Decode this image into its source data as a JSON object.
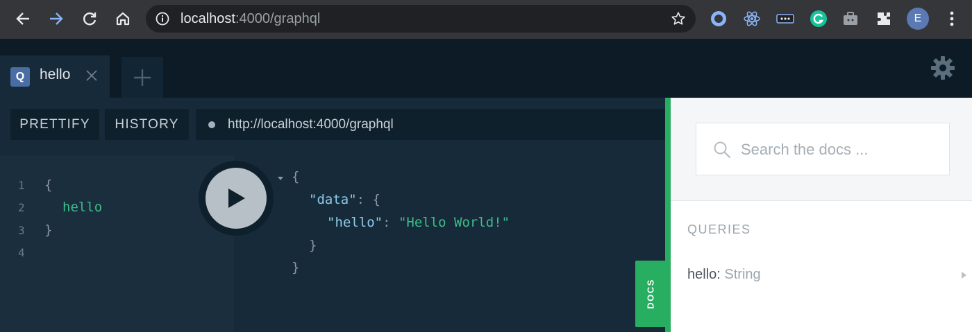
{
  "browser": {
    "url_host": "localhost",
    "url_rest": ":4000/graphql",
    "profile_initial": "E"
  },
  "tabs": [
    {
      "badge": "Q",
      "title": "hello"
    }
  ],
  "toolbar": {
    "prettify_label": "PRETTIFY",
    "history_label": "HISTORY",
    "endpoint_value": "http://localhost:4000/graphql"
  },
  "query_editor": {
    "line_numbers": [
      "1",
      "2",
      "3",
      "4"
    ],
    "lines": [
      "{",
      "hello",
      "}"
    ]
  },
  "result": {
    "open_brace": "{",
    "data_key": "\"data\"",
    "colon1": ": {",
    "hello_key": "\"hello\"",
    "colon2": ": ",
    "hello_value": "\"Hello World!\"",
    "inner_close": "}",
    "outer_close": "}"
  },
  "docs": {
    "tab_label": "DOCS",
    "search_placeholder": "Search the docs ...",
    "queries_heading": "QUERIES",
    "query_field_name": "hello",
    "query_field_sep": ": ",
    "query_field_type": "String"
  },
  "colors": {
    "accent_green": "#27ae60",
    "editor_bg": "#172a3a",
    "field_green": "#3dbd8a"
  }
}
